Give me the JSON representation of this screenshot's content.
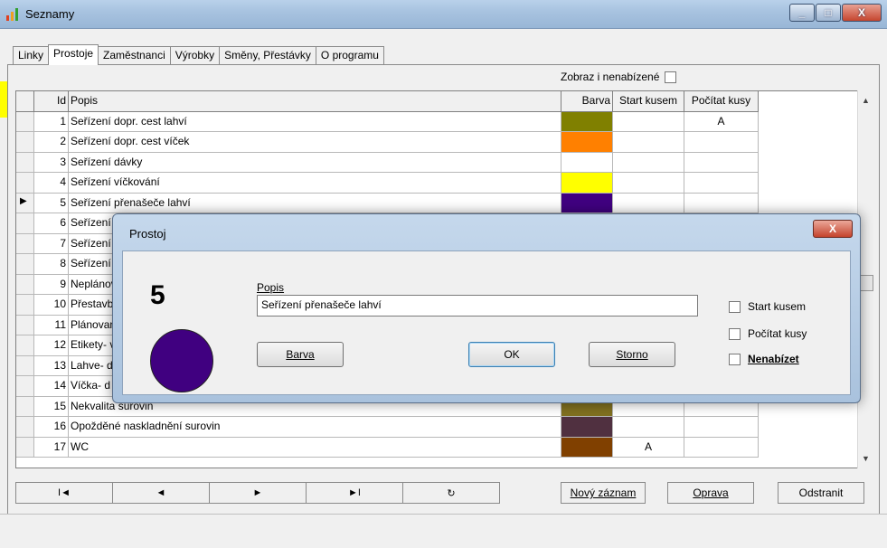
{
  "window": {
    "title": "Seznamy",
    "minimize": "_",
    "maximize": "□",
    "close": "X"
  },
  "tabs": [
    "Linky",
    "Prostoje",
    "Zaměstnanci",
    "Výrobky",
    "Směny, Přestávky",
    "O programu"
  ],
  "active_tab": "Prostoje",
  "filter": {
    "label": "Zobraz i nenabízené"
  },
  "grid": {
    "headers": {
      "id": "Id",
      "popis": "Popis",
      "barva": "Barva",
      "start": "Start kusem",
      "pocitat": "Počítat kusy"
    },
    "rows": [
      {
        "id": "1",
        "popis": "Seřízení dopr. cest lahví",
        "color": "#808000",
        "start": "",
        "pocitat": "A"
      },
      {
        "id": "2",
        "popis": "Seřízení dopr. cest víček",
        "color": "#ff8000",
        "start": "",
        "pocitat": ""
      },
      {
        "id": "3",
        "popis": "Seřízení dávky",
        "color": "#ffffff",
        "start": "",
        "pocitat": ""
      },
      {
        "id": "4",
        "popis": "Seřízení víčkování",
        "color": "#ffff00",
        "start": "",
        "pocitat": ""
      },
      {
        "id": "5",
        "popis": "Seřízení přenašeče lahví",
        "color": "#400080",
        "start": "",
        "pocitat": ""
      },
      {
        "id": "6",
        "popis": "Seřízení",
        "color": "#d080e0",
        "start": "",
        "pocitat": ""
      },
      {
        "id": "7",
        "popis": "Seřízení",
        "color": "#40c0c0",
        "start": "",
        "pocitat": ""
      },
      {
        "id": "8",
        "popis": "Seřízení",
        "color": "#ffffff",
        "start": "",
        "pocitat": ""
      },
      {
        "id": "9",
        "popis": "Neplánova",
        "color": "#ffffff",
        "start": "",
        "pocitat": ""
      },
      {
        "id": "10",
        "popis": "Přestavb",
        "color": "#ffffff",
        "start": "",
        "pocitat": ""
      },
      {
        "id": "11",
        "popis": "Plánovan",
        "color": "#ffffff",
        "start": "",
        "pocitat": ""
      },
      {
        "id": "12",
        "popis": "Etikety- v",
        "color": "#ffffff",
        "start": "",
        "pocitat": ""
      },
      {
        "id": "13",
        "popis": "Lahve- d",
        "color": "#ffffff",
        "start": "",
        "pocitat": ""
      },
      {
        "id": "14",
        "popis": "Víčka- d",
        "color": "#ffffff",
        "start": "",
        "pocitat": ""
      },
      {
        "id": "15",
        "popis": "Nekvalita surovin",
        "color": "#807020",
        "start": "",
        "pocitat": ""
      },
      {
        "id": "16",
        "popis": "Opožděné naskladnění surovin",
        "color": "#503040",
        "start": "",
        "pocitat": ""
      },
      {
        "id": "17",
        "popis": "WC",
        "color": "#804000",
        "start": "A",
        "pocitat": ""
      }
    ],
    "current_row_index": 4
  },
  "nav": {
    "first": "I◄",
    "prev": "◄",
    "next": "►",
    "last": "►I",
    "refresh": "↻"
  },
  "actions": {
    "new": "Nový záznam",
    "edit": "Oprava",
    "delete": "Odstranit"
  },
  "dialog": {
    "title": "Prostoj",
    "close": "X",
    "number": "5",
    "circle_color": "#400080",
    "popis_label": "Popis",
    "popis_value": "Seřízení přenašeče lahví",
    "barva_button": "Barva",
    "ok_button": "OK",
    "storno_button": "Storno",
    "checkboxes": {
      "start": "Start kusem",
      "pocitat": "Počítat kusy",
      "nenabizet": "Nenabízet"
    }
  }
}
